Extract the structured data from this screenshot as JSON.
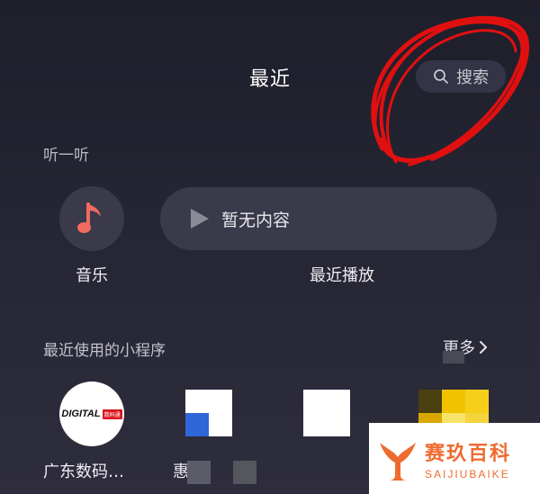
{
  "header": {
    "title": "最近",
    "search_label": "搜索"
  },
  "listen": {
    "section_title": "听一听",
    "music_label": "音乐",
    "empty_text": "暂无内容",
    "recent_play_label": "最近播放"
  },
  "mini_programs": {
    "section_title": "最近使用的小程序",
    "more_label": "更多",
    "apps": [
      {
        "label": "广东数码…",
        "logo_text": "DIGITAL",
        "badge_text": "数码通"
      },
      {
        "label": "惠"
      },
      {
        "label": ""
      },
      {
        "label": ""
      }
    ]
  },
  "watermark": {
    "cn": "赛玖百科",
    "en": "SAIJIUBAIKE"
  },
  "colors": {
    "background": "#252533",
    "card": "#3a3a4a",
    "music_note": "#f26b63",
    "annotation_red": "#e01010",
    "watermark_orange": "#ee6b2f"
  }
}
